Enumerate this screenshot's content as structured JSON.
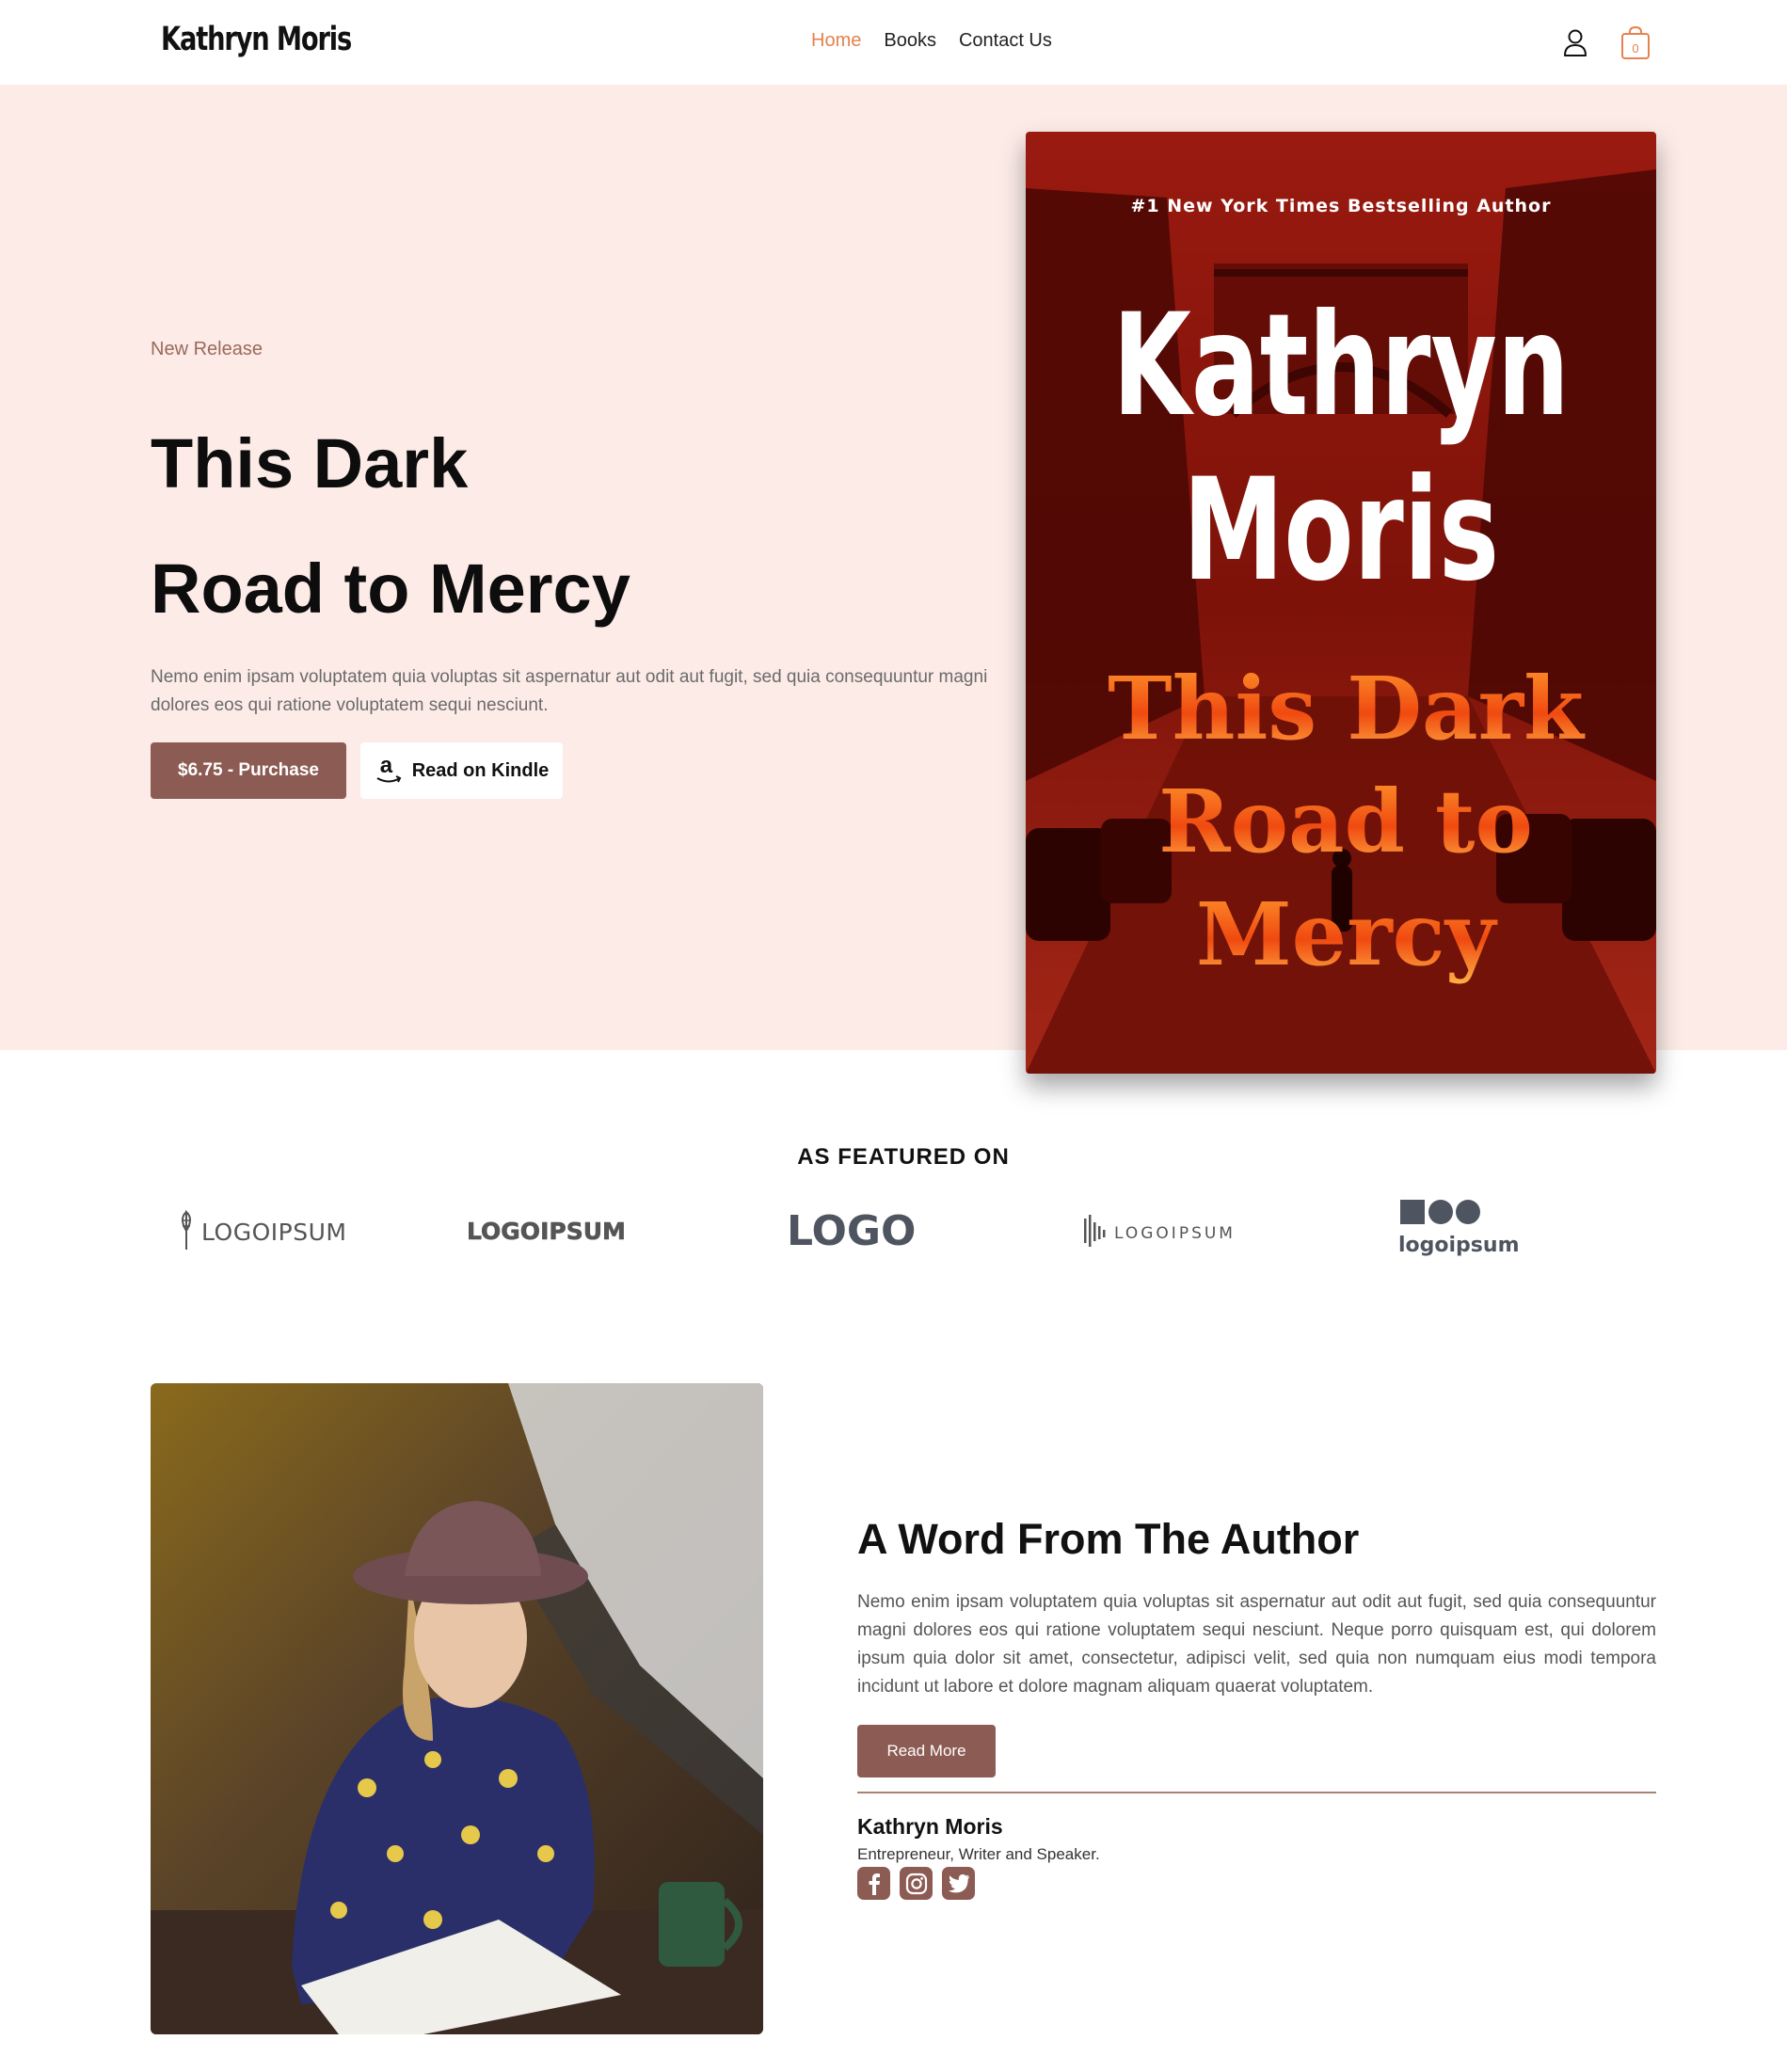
{
  "header": {
    "logo": "Kathryn Moris",
    "nav": [
      "Home",
      "Books",
      "Contact Us"
    ],
    "active_nav": "Home",
    "icons": [
      "user-icon",
      "shopping-bag-icon"
    ],
    "cart_count": "0"
  },
  "hero": {
    "eyebrow": "New Release",
    "title_line1": "This Dark",
    "title_line2": "Road to Mercy",
    "description": "Nemo enim ipsam voluptatem quia voluptas sit aspernatur aut odit aut fugit, sed quia consequuntur magni dolores eos qui ratione voluptatem sequi nesciunt.",
    "purchase_label": "$6.75 - Purchase",
    "kindle_label": "Read on Kindle"
  },
  "book_cover": {
    "tagline": "#1 New York Times Bestselling Author",
    "author_line1": "Kathryn",
    "author_line2": "Moris",
    "title_line1": "This Dark",
    "title_line2": "Road to",
    "title_line3": "Mercy"
  },
  "featured": {
    "heading": "AS FEATURED ON",
    "logos": [
      "LOGOIPSUM",
      "LOGOIPSUM",
      "LOGO",
      "LOGOIPSUM",
      "logoipsum"
    ]
  },
  "author": {
    "heading": "A Word From The Author",
    "text": "Nemo enim ipsam voluptatem quia voluptas sit aspernatur aut odit aut fugit, sed quia consequuntur magni dolores eos qui ratione voluptatem sequi nesciunt. Neque porro quisquam est, qui dolorem ipsum quia dolor sit amet, consectetur, adipisci velit, sed quia non numquam eius modi tempora incidunt ut labore et dolore magnam aliquam quaerat voluptatem.",
    "read_more_label": "Read More",
    "name": "Kathryn Moris",
    "role": "Entrepreneur, Writer and Speaker.",
    "social": [
      "facebook-icon",
      "instagram-icon",
      "twitter-icon"
    ]
  },
  "colors": {
    "accent": "#8c5b53",
    "nav_active": "#e5824e",
    "hero_bg": "#fcebe7",
    "cover_red": "#8d150e"
  }
}
